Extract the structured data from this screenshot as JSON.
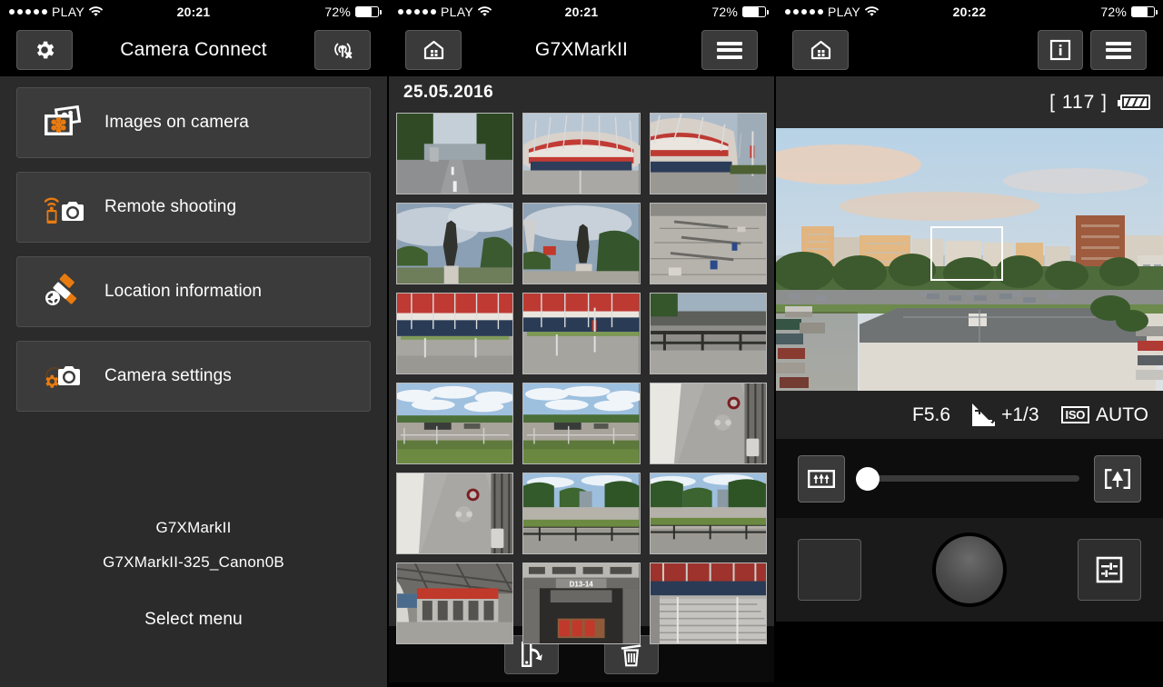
{
  "app": {
    "accent": "#e87b10",
    "panel_bg": "#2b2b2b",
    "row_bg": "#3b3b3b"
  },
  "panel1": {
    "status": {
      "carrier": "PLAY",
      "time": "20:21",
      "battery": "72%",
      "wifi_icon": "wifi-icon",
      "battery_icon": "battery-icon"
    },
    "nav": {
      "left_icon": "gear-icon",
      "title": "Camera Connect",
      "right_icon": "wifi-disconnect-icon"
    },
    "menu": [
      {
        "label": "Images on camera",
        "icon": "photos-icon"
      },
      {
        "label": "Remote shooting",
        "icon": "remote-shooting-icon"
      },
      {
        "label": "Location information",
        "icon": "satellite-icon"
      },
      {
        "label": "Camera settings",
        "icon": "camera-settings-icon"
      }
    ],
    "footer": {
      "camera_model": "G7XMarkII",
      "ssid": "G7XMarkII-325_Canon0B",
      "hint": "Select menu"
    }
  },
  "panel2": {
    "status": {
      "carrier": "PLAY",
      "time": "20:21",
      "battery": "72%",
      "wifi_icon": "wifi-icon",
      "battery_icon": "battery-icon"
    },
    "nav": {
      "left_icon": "home-icon",
      "title": "G7XMarkII",
      "right_icon": "hamburger-menu-icon"
    },
    "date": "25.05.2016",
    "thumbnails": [
      {
        "id": 1,
        "caption": "tree-lined road"
      },
      {
        "id": 2,
        "caption": "national stadium front"
      },
      {
        "id": 3,
        "caption": "national stadium angle"
      },
      {
        "id": 4,
        "caption": "statue against sky"
      },
      {
        "id": 5,
        "caption": "statue with flags"
      },
      {
        "id": 6,
        "caption": "empty parking lot"
      },
      {
        "id": 7,
        "caption": "stadium facade red"
      },
      {
        "id": 8,
        "caption": "stadium facade with flag"
      },
      {
        "id": 9,
        "caption": "railing walkway"
      },
      {
        "id": 10,
        "caption": "riverside panorama"
      },
      {
        "id": 11,
        "caption": "riverside panorama 2"
      },
      {
        "id": 12,
        "caption": "stadium pillar closeup"
      },
      {
        "id": 13,
        "caption": "stadium pillar closeup 2"
      },
      {
        "id": 14,
        "caption": "park path with railing"
      },
      {
        "id": 15,
        "caption": "park path with railing 2"
      },
      {
        "id": 16,
        "caption": "stadium entrance turnstiles"
      },
      {
        "id": 17,
        "caption": "concourse gate D13-14",
        "label": "D13-14"
      },
      {
        "id": 18,
        "caption": "stadium stairs"
      }
    ],
    "toolbar": [
      {
        "action": "save-to-phone",
        "icon": "save-to-device-icon"
      },
      {
        "action": "delete",
        "icon": "trash-icon"
      }
    ]
  },
  "panel3": {
    "status": {
      "carrier": "PLAY",
      "time": "20:22",
      "battery": "72%",
      "wifi_icon": "wifi-icon",
      "battery_icon": "battery-icon"
    },
    "nav": {
      "left_icon": "home-icon",
      "info_icon": "info-icon",
      "right_icon": "hamburger-menu-icon"
    },
    "info": {
      "shots_remaining": "[ 117 ]",
      "camera_battery_icon": "camera-battery-icon"
    },
    "liveview": {
      "af_frame": "af-frame"
    },
    "exposure": {
      "aperture": "F5.6",
      "ev_icon": "exposure-compensation-icon",
      "ev_value": "+1/3",
      "iso_icon": "ISO",
      "iso_value": "AUTO"
    },
    "zoom": {
      "wide_icon": "zoom-wide-icon",
      "tele_icon": "zoom-tele-icon",
      "position_pct": 0
    },
    "controls": {
      "preview_thumb": "last-shot-preview",
      "shutter": "shutter-button",
      "settings_icon": "sliders-icon"
    }
  }
}
